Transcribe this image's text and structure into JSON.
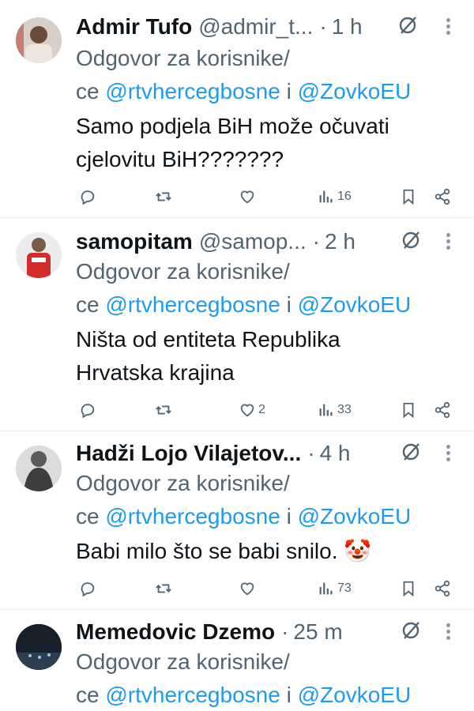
{
  "tweets": [
    {
      "name": "Admir Tufo",
      "handle": "@admir_t...",
      "dot": "·",
      "time": "1 h",
      "reply_prefix": "Odgovor za korisnike/",
      "reply_ce": "ce",
      "mention1": "@rtvhercegbosne",
      "reply_i": "i",
      "mention2": "@ZovkoEU",
      "body": [
        "Samo podjela BiH može očuvati",
        "cjelovitu BiH???????"
      ],
      "likes": "",
      "views": "16"
    },
    {
      "name": "samopitam",
      "handle": "@samop...",
      "dot": "·",
      "time": "2 h",
      "reply_prefix": "Odgovor za korisnike/",
      "reply_ce": "ce",
      "mention1": "@rtvhercegbosne",
      "reply_i": "i",
      "mention2": "@ZovkoEU",
      "body": [
        "Ništa od entiteta Republika",
        "Hrvatska krajina"
      ],
      "likes": "2",
      "views": "33"
    },
    {
      "name": "Hadži Lojo Vilajetov...",
      "handle": "",
      "dot": "·",
      "time": "4 h",
      "reply_prefix": "Odgovor za korisnike/",
      "reply_ce": "ce",
      "mention1": "@rtvhercegbosne",
      "reply_i": "i",
      "mention2": "@ZovkoEU",
      "body": [
        "Babi milo što se babi snilo. 🤡"
      ],
      "likes": "",
      "views": "73"
    },
    {
      "name": "Memedovic Dzemo",
      "handle": "",
      "dot": "·",
      "time": "25 m",
      "reply_prefix": "Odgovor za korisnike/",
      "reply_ce": "ce",
      "mention1": "@rtvhercegbosne",
      "reply_i": "i",
      "mention2": "@ZovkoEU",
      "body": [],
      "likes": "",
      "views": ""
    }
  ],
  "icons": {
    "reply": "reply-icon",
    "retweet": "retweet-icon",
    "like": "heart-icon",
    "views": "views-icon",
    "bookmark": "bookmark-icon",
    "share": "share-icon",
    "grok": "grok-icon",
    "more": "more-icon"
  },
  "colors": {
    "text": "#0f1419",
    "muted": "#536471",
    "link": "#1d9bf0"
  }
}
